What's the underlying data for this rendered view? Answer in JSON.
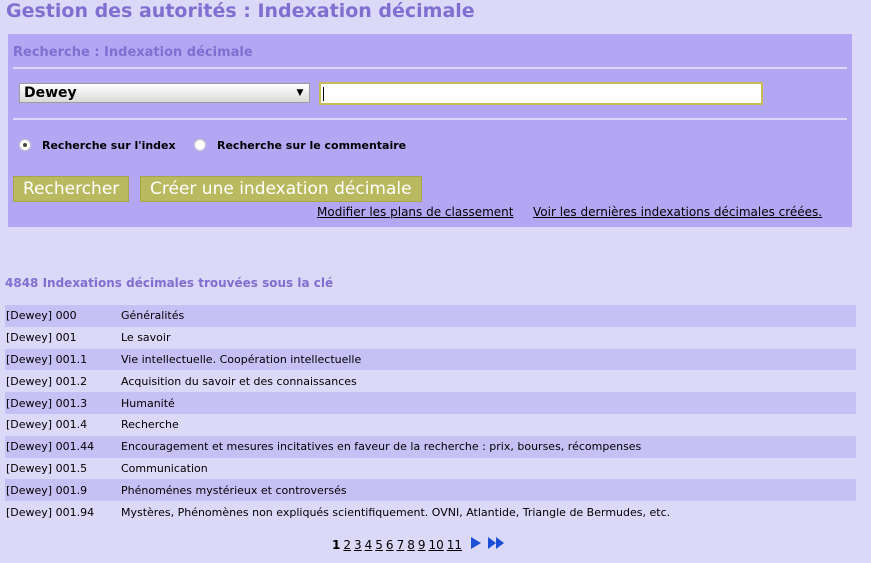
{
  "page": {
    "title": "Gestion des autorités : Indexation décimale"
  },
  "search": {
    "panel_title": "Recherche : Indexation décimale",
    "select_value": "Dewey",
    "input_value": "",
    "radio_index_label": "Recherche sur l'index",
    "radio_index_checked": true,
    "radio_comment_label": "Recherche sur le commentaire",
    "radio_comment_checked": false,
    "search_button": "Rechercher",
    "create_button": "Créer une indexation décimale",
    "link_plans": "Modifier les plans de classement",
    "link_latest": "Voir les dernières indexations décimales créées."
  },
  "results": {
    "title": "4848 Indexations décimales trouvées sous la clé",
    "rows": [
      {
        "code": "[Dewey] 000",
        "label": "Généralités"
      },
      {
        "code": "[Dewey] 001",
        "label": "Le savoir"
      },
      {
        "code": "[Dewey] 001.1",
        "label": "Vie intellectuelle. Coopération intellectuelle"
      },
      {
        "code": "[Dewey] 001.2",
        "label": "Acquisition du savoir et des connaissances"
      },
      {
        "code": "[Dewey] 001.3",
        "label": "Humanité"
      },
      {
        "code": "[Dewey] 001.4",
        "label": "Recherche"
      },
      {
        "code": "[Dewey] 001.44",
        "label": "Encouragement et mesures incitatives en faveur de la recherche : prix, bourses, récompenses"
      },
      {
        "code": "[Dewey] 001.5",
        "label": "Communication"
      },
      {
        "code": "[Dewey] 001.9",
        "label": "Phénoménes mystérieux et controversés"
      },
      {
        "code": "[Dewey] 001.94",
        "label": "Mystères, Phénomènes non expliqués scientifiquement. OVNI, Atlantide, Triangle de Bermudes, etc."
      }
    ]
  },
  "pagination": {
    "current": "1",
    "pages": [
      "2",
      "3",
      "4",
      "5",
      "6",
      "7",
      "8",
      "9",
      "10",
      "11"
    ],
    "next_icon": "next-arrow-icon",
    "last_icon": "last-page-icon"
  }
}
